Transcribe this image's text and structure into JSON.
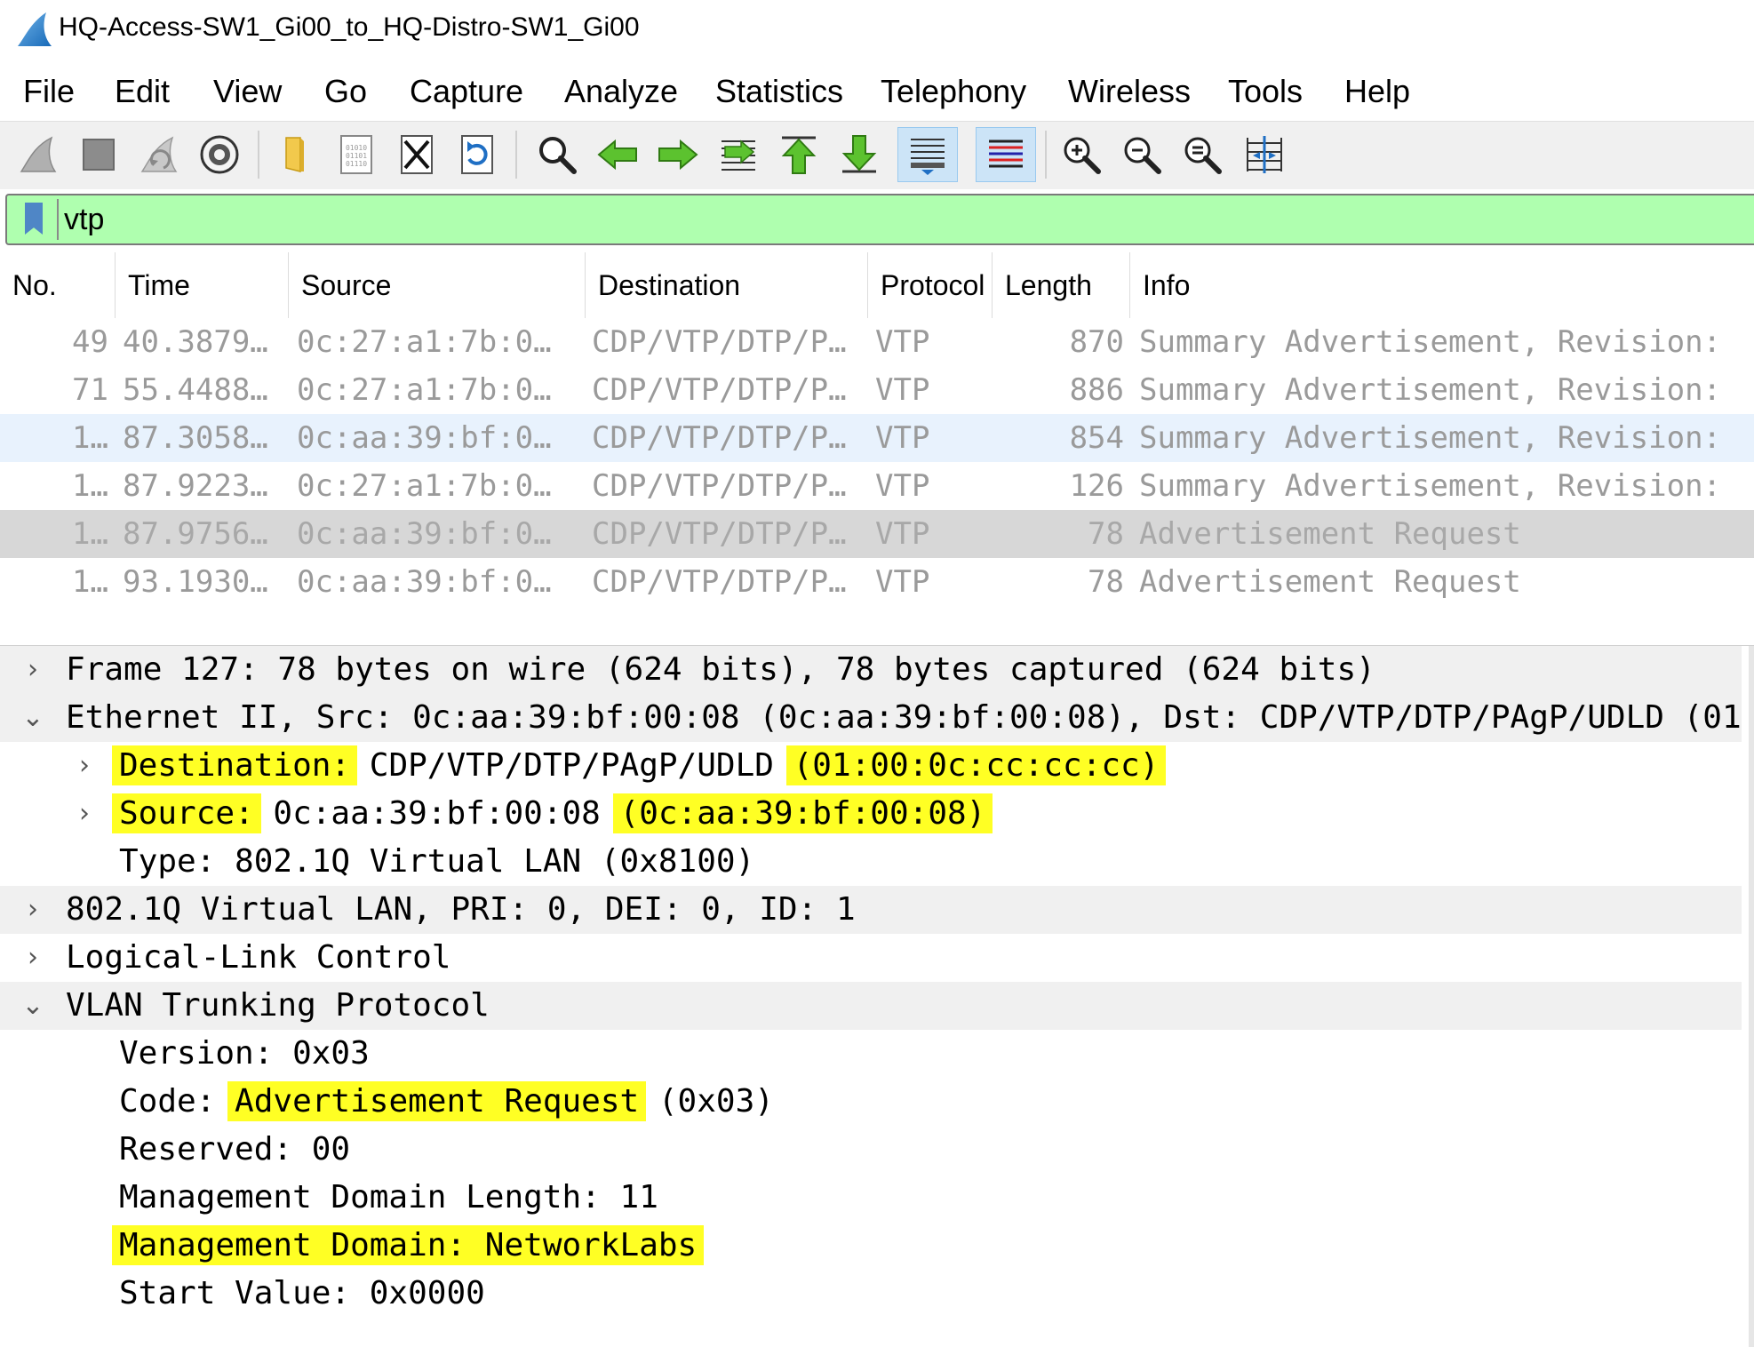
{
  "window": {
    "title": "HQ-Access-SW1_Gi00_to_HQ-Distro-SW1_Gi00",
    "app_icon": "wireshark-fin-icon"
  },
  "menu": [
    "File",
    "Edit",
    "View",
    "Go",
    "Capture",
    "Analyze",
    "Statistics",
    "Telephony",
    "Wireless",
    "Tools",
    "Help"
  ],
  "toolbar": {
    "icons": [
      "start-capture-icon",
      "stop-capture-icon",
      "restart-capture-icon",
      "capture-options-icon",
      "open-file-icon",
      "save-file-icon",
      "close-file-icon",
      "reload-file-icon",
      "find-packet-icon",
      "go-back-icon",
      "go-forward-icon",
      "go-to-packet-icon",
      "first-packet-icon",
      "last-packet-icon",
      "autoscroll-icon",
      "colorize-icon",
      "zoom-in-icon",
      "zoom-out-icon",
      "normal-size-icon",
      "resize-columns-icon"
    ],
    "active": [
      "autoscroll-icon",
      "colorize-icon"
    ]
  },
  "filter": {
    "value": "vtp",
    "color": "#afffaf"
  },
  "packet_list": {
    "columns": [
      "No.",
      "Time",
      "Source",
      "Destination",
      "Protocol",
      "Length",
      "Info"
    ],
    "rows": [
      {
        "no": "49",
        "time": "40.3879…",
        "source": "0c:27:a1:7b:0…",
        "destination": "CDP/VTP/DTP/P…",
        "protocol": "VTP",
        "length": "870",
        "info": "Summary Advertisement, Revision:",
        "state": "normal"
      },
      {
        "no": "71",
        "time": "55.4488…",
        "source": "0c:27:a1:7b:0…",
        "destination": "CDP/VTP/DTP/P…",
        "protocol": "VTP",
        "length": "886",
        "info": "Summary Advertisement, Revision:",
        "state": "normal"
      },
      {
        "no": "1…",
        "time": "87.3058…",
        "source": "0c:aa:39:bf:0…",
        "destination": "CDP/VTP/DTP/P…",
        "protocol": "VTP",
        "length": "854",
        "info": "Summary Advertisement, Revision:",
        "state": "hover"
      },
      {
        "no": "1…",
        "time": "87.9223…",
        "source": "0c:27:a1:7b:0…",
        "destination": "CDP/VTP/DTP/P…",
        "protocol": "VTP",
        "length": "126",
        "info": "Summary Advertisement, Revision:",
        "state": "normal"
      },
      {
        "no": "1…",
        "time": "87.9756…",
        "source": "0c:aa:39:bf:0…",
        "destination": "CDP/VTP/DTP/P…",
        "protocol": "VTP",
        "length": "78",
        "info": "Advertisement Request",
        "state": "selected"
      },
      {
        "no": "1…",
        "time": "93.1930…",
        "source": "0c:aa:39:bf:0…",
        "destination": "CDP/VTP/DTP/P…",
        "protocol": "VTP",
        "length": "78",
        "info": "Advertisement Request",
        "state": "normal"
      }
    ]
  },
  "details": {
    "frame": "Frame 127: 78 bytes on wire (624 bits), 78 bytes captured (624 bits)",
    "ethernet": "Ethernet II, Src: 0c:aa:39:bf:00:08 (0c:aa:39:bf:00:08), Dst: CDP/VTP/DTP/PAgP/UDLD (01:",
    "eth_dst_label": "Destination:",
    "eth_dst_name": " CDP/VTP/DTP/PAgP/UDLD ",
    "eth_dst_addr": "(01:00:0c:cc:cc:cc)",
    "eth_src_label": "Source:",
    "eth_src_name": " 0c:aa:39:bf:00:08 ",
    "eth_src_addr": "(0c:aa:39:bf:00:08)",
    "eth_type": "Type: 802.1Q Virtual LAN (0x8100)",
    "vlan": "802.1Q Virtual LAN, PRI: 0, DEI: 0, ID: 1",
    "llc": "Logical-Link Control",
    "vtp": "VLAN Trunking Protocol",
    "vtp_version": "Version: 0x03",
    "vtp_code_label": "Code: ",
    "vtp_code_value": "Advertisement Request",
    "vtp_code_hex": " (0x03)",
    "vtp_reserved": "Reserved: 00",
    "vtp_domain_length": "Management Domain Length: 11",
    "vtp_domain": "Management Domain: NetworkLabs",
    "vtp_start_value": "Start Value: 0x0000",
    "highlight_color": "#ffff24"
  }
}
